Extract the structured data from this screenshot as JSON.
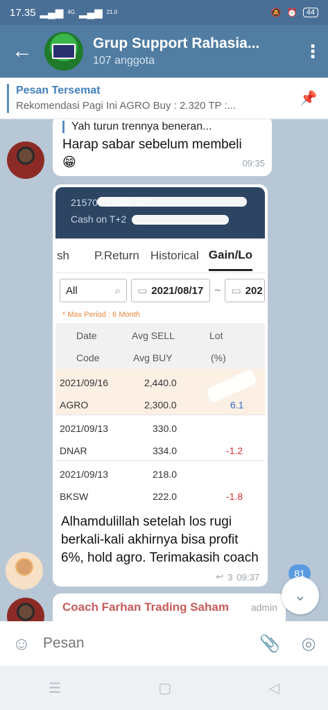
{
  "status": {
    "time": "17.35",
    "network": "4G",
    "speed": "21.0",
    "speed_unit": "KB/S",
    "battery": "44"
  },
  "header": {
    "title": "Grup Support Rahasia...",
    "subtitle": "107 anggota"
  },
  "pinned": {
    "label": "Pesan Tersemat",
    "text": "Rekomendasi Pagi Ini  AGRO  Buy : 2.320 TP :..."
  },
  "messages": {
    "m1": {
      "reply_text": "Yah turun trennya beneran...",
      "text": "Harap sabar sebelum membeli",
      "emoji": "😁",
      "time": "09:35"
    },
    "m2": {
      "screenshot": {
        "head_line1": "215707  YUGA RIZ...",
        "head_line2": "Cash on T+2",
        "tabs": [
          "sh",
          "P.Return",
          "Historical",
          "Gain/Lo"
        ],
        "filter_all": "All",
        "date_from": "2021/08/17",
        "date_to": "202",
        "max_period": "* Max Period : 6 Month",
        "col_date": "Date",
        "col_avg_sell": "Avg SELL",
        "col_lot": "Lot",
        "col_code": "Code",
        "col_avg_buy": "Avg BUY",
        "col_pct": "(%)",
        "rows": [
          {
            "date": "2021/09/16",
            "sell": "2,440.0",
            "code": "AGRO",
            "buy": "2,300.0",
            "pct": "6.1"
          },
          {
            "date": "2021/09/13",
            "sell": "330.0",
            "code": "DNAR",
            "buy": "334.0",
            "pct": "-1.2"
          },
          {
            "date": "2021/09/13",
            "sell": "218.0",
            "code": "BKSW",
            "buy": "222.0",
            "pct": "-1.8"
          }
        ]
      },
      "text": "Alhamdulillah setelah los rugi berkali-kali akhirnya bisa profit 6%, hold agro. Terimakasih coach",
      "replies": "3",
      "time": "09:37"
    },
    "m3": {
      "sender": "Coach Farhan Trading Saham",
      "badge": "admin"
    }
  },
  "fab": {
    "unread": "81"
  },
  "composer": {
    "placeholder": "Pesan"
  },
  "colors": {
    "header": "#517da2",
    "accent": "#5a8cc2",
    "profit": "#2f6cc9",
    "loss": "#dd3333"
  }
}
